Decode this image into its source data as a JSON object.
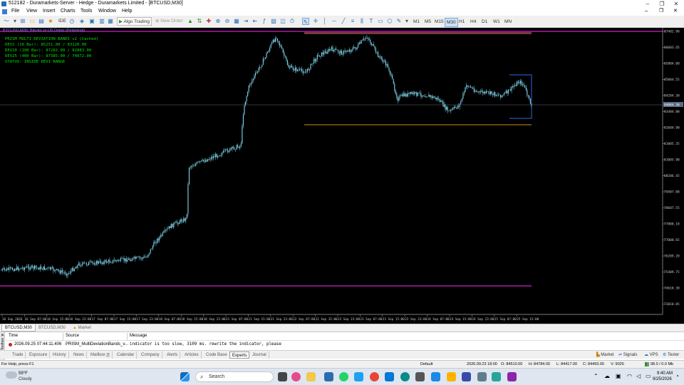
{
  "window": {
    "title": "512182 - Duramarkets-Server - Hedge - Duramarkets Limited - [BTCUSD,M30]",
    "controls": [
      "–",
      "❐",
      "✕"
    ]
  },
  "menu": [
    "File",
    "View",
    "Insert",
    "Charts",
    "Tools",
    "Window",
    "Help"
  ],
  "toolbar": {
    "ide": "IDE",
    "algo_trading": "Algo Trading",
    "new_order": "New Order",
    "timeframes": [
      "M1",
      "M5",
      "M15",
      "M30",
      "H1",
      "H4",
      "D1",
      "W1",
      "MN"
    ],
    "active_timeframe": "M30"
  },
  "chart": {
    "symbol_header": "BTCUSD,M30: Bitcoin vs US Dollar (Perpetual)",
    "indicator": {
      "title": "PRISM MULTI-DEVIATION BANDS v2 (Cached)",
      "lines": [
        "DEV1  (16 Bar):  85251.00 / 83120.00",
        "DEV10 (100 Bar): 87282.00 / 82883.00",
        "DEV25 (400 Bar): 87385.00 / 74872.00",
        "STATUS: INSIDE DEV1 RANGE"
      ]
    },
    "price_labels": [
      "87402.90",
      "86603.45",
      "85804.00",
      "85004.55",
      "84204.30",
      "83404.80",
      "82604.90",
      "81805.35",
      "81005.90",
      "80206.45",
      "79407.00",
      "78607.55",
      "77808.10",
      "77008.65",
      "76209.20",
      "75409.75",
      "74610.30",
      "73810.85"
    ],
    "current_price": "84004.30",
    "time_labels": [
      "16 Sep 2026",
      "16 Sep 07:00",
      "16 Sep 15:00",
      "16 Sep 23:00",
      "17 Sep 07:00",
      "17 Sep 15:00",
      "17 Sep 23:00",
      "18 Sep 07:00",
      "18 Sep 15:00",
      "18 Sep 23:00",
      "21 Sep 07:00",
      "21 Sep 15:00",
      "21 Sep 23:00",
      "22 Sep 07:00",
      "22 Sep 15:00",
      "22 Sep 23:00",
      "23 Sep 07:00",
      "23 Sep 15:00",
      "23 Sep 23:00",
      "24 Sep 07:00",
      "24 Sep 15:00",
      "24 Sep 23:00",
      "25 Sep 07:00",
      "25 Sep 15:00"
    ],
    "colors": {
      "candle": "#7fd7ee",
      "dev25": "#d020d0",
      "dev10": "#d08a20",
      "dev1": "#2f68e0",
      "osd": "#00e000"
    }
  },
  "chart_tabs": [
    "BTCUSD,M30",
    "BTCUSD,M30",
    "Market"
  ],
  "toolbox": {
    "side_label": "Toolbox",
    "columns": [
      "Time",
      "Source",
      "Message"
    ],
    "rows": [
      {
        "time": "2026.09.25 07:44:11.406",
        "source": "PRISM_MultiDeviationBands_v...",
        "message": "indicator is too slow, 3109 ms. rewrite the indicator, please"
      }
    ],
    "tabs": [
      "Trade",
      "Exposure",
      "History",
      "News",
      "Mailbox",
      "Calendar",
      "Company",
      "Alerts",
      "Articles",
      "Code Base",
      "Experts",
      "Journal"
    ],
    "active_tab": "Experts",
    "mailbox_count": "7",
    "right_buttons": [
      "Market",
      "Signals",
      "VPS",
      "Tester"
    ]
  },
  "statusbar": {
    "help": "For Help, press F1",
    "profile": "Default",
    "datetime": "2026.09.23 18:00",
    "open": "O: 84510.00",
    "high": "H: 84784.00",
    "low": "L: 84417.00",
    "close": "C: 84493.00",
    "volume": "V: 9026",
    "traffic": "98.0 / 0.0 Mb"
  },
  "taskbar": {
    "weather_temp": "59°F",
    "weather_desc": "Cloudy",
    "search_placeholder": "Search",
    "time": "9:40 AM",
    "date": "9/25/2026"
  }
}
